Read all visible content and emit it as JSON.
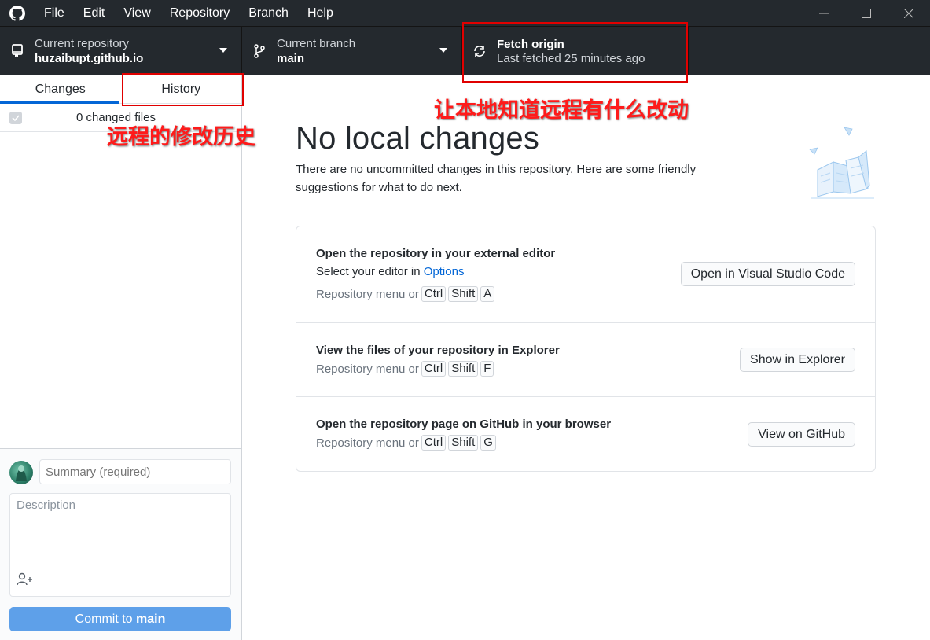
{
  "titlebar": {
    "menu": [
      "File",
      "Edit",
      "View",
      "Repository",
      "Branch",
      "Help"
    ]
  },
  "toolbar": {
    "repo": {
      "label": "Current repository",
      "value": "huzaibupt.github.io"
    },
    "branch": {
      "label": "Current branch",
      "value": "main"
    },
    "fetch": {
      "label": "Fetch origin",
      "status": "Last fetched 25 minutes ago"
    }
  },
  "sidebar": {
    "tabs": [
      "Changes",
      "History"
    ],
    "active_tab": "Changes",
    "changed_files": "0 changed files",
    "summary_placeholder": "Summary (required)",
    "description_placeholder": "Description",
    "commit_prefix": "Commit to ",
    "commit_branch": "main"
  },
  "main": {
    "heading": "No local changes",
    "subtext": "There are no uncommitted changes in this repository. Here are some friendly suggestions for what to do next.",
    "actions": [
      {
        "title": "Open the repository in your external editor",
        "sub_prefix": "Select your editor in ",
        "sub_link": "Options",
        "shortcut_prefix": "Repository menu or",
        "keys": [
          "Ctrl",
          "Shift",
          "A"
        ],
        "button": "Open in Visual Studio Code"
      },
      {
        "title": "View the files of your repository in Explorer",
        "shortcut_prefix": "Repository menu or",
        "keys": [
          "Ctrl",
          "Shift",
          "F"
        ],
        "button": "Show in Explorer"
      },
      {
        "title": "Open the repository page on GitHub in your browser",
        "shortcut_prefix": "Repository menu or",
        "keys": [
          "Ctrl",
          "Shift",
          "G"
        ],
        "button": "View on GitHub"
      }
    ]
  },
  "annotations": {
    "history_note": "远程的修改历史",
    "fetch_note": "让本地知道远程有什么改动"
  },
  "colors": {
    "titlebar_bg": "#24292e",
    "accent_blue": "#0366d6",
    "commit_button": "#5ea0e9",
    "annotation_red": "#e00000"
  }
}
